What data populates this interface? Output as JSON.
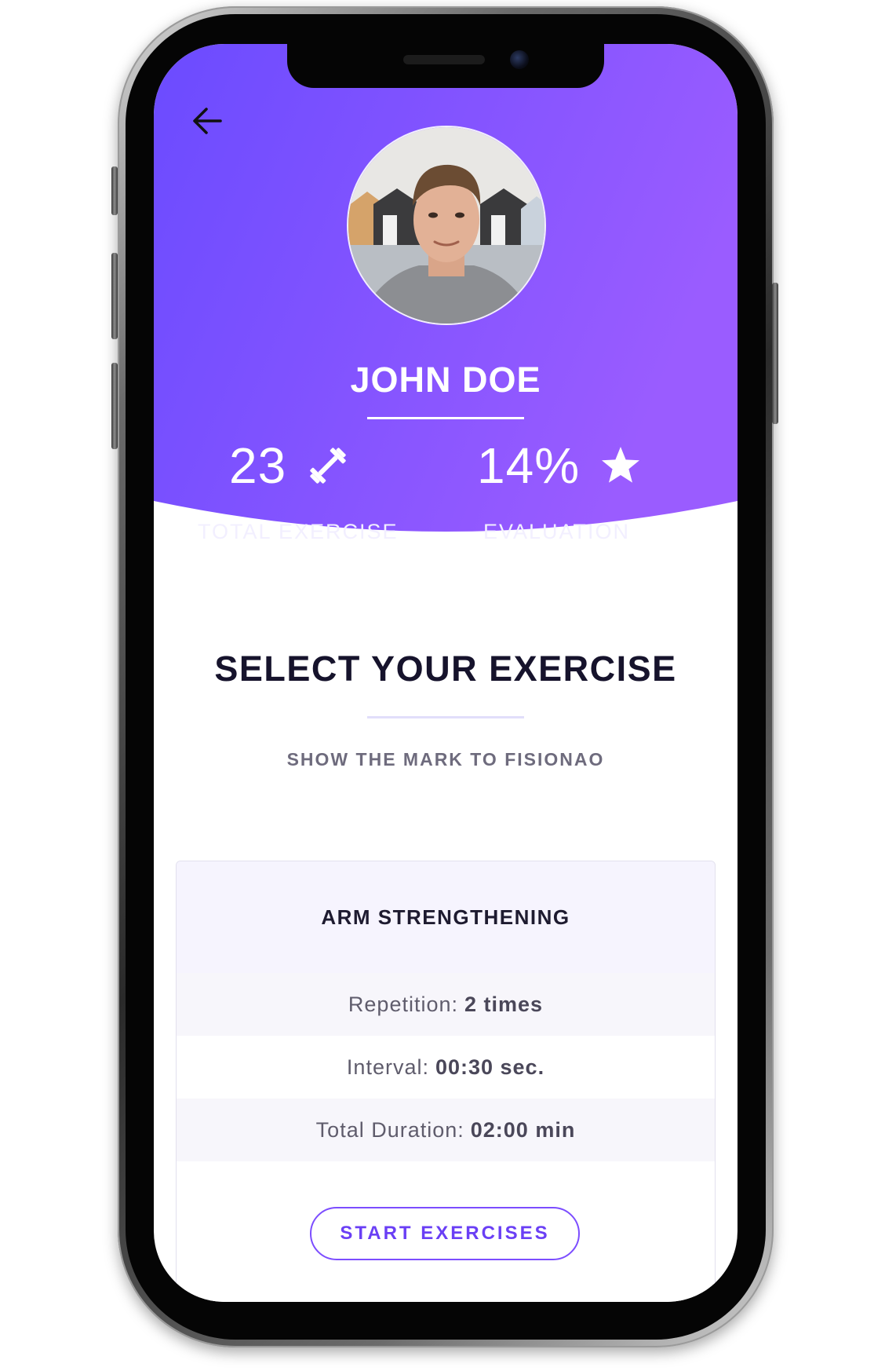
{
  "theme": {
    "gradient_start": "#6b4bff",
    "gradient_end": "#9a5cff",
    "accent": "#7c4dff",
    "title_color": "#16132c"
  },
  "header": {
    "back_icon": "arrow-left-icon",
    "user_name": "JOHN DOE",
    "stats": {
      "exercise": {
        "value": "23",
        "label": "TOTAL EXERCISE",
        "icon": "dumbbell-icon"
      },
      "evaluation": {
        "value": "14%",
        "label": "EVALUATION",
        "icon": "star-icon"
      }
    }
  },
  "section": {
    "title": "SELECT YOUR EXERCISE",
    "subtitle": "SHOW THE MARK TO FISIONAO"
  },
  "exercise_card": {
    "title": "ARM STRENGTHENING",
    "repetition_label": "Repetition:",
    "repetition_value": "2 times",
    "interval_label": "Interval:",
    "interval_value": "00:30 sec.",
    "duration_label": "Total Duration:",
    "duration_value": "02:00 min",
    "start_label": "START EXERCISES"
  }
}
